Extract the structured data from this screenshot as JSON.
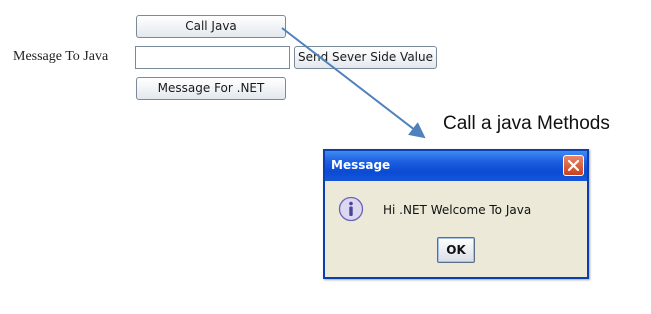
{
  "form": {
    "call_java_label": "Call Java",
    "message_label": "Message To Java",
    "message_value": "",
    "send_server_label": "Send Sever Side Value",
    "message_net_label": "Message For .NET"
  },
  "annotation": {
    "text": "Call a java Methods",
    "arrow_color": "#4f81bd"
  },
  "dialog": {
    "title": "Message",
    "message": "Hi .NET Welcome To Java",
    "ok_label": "OK",
    "icon": "info-icon",
    "close_icon": "close-icon",
    "titlebar_color": "#0b4ad4",
    "close_color": "#c8411b"
  }
}
